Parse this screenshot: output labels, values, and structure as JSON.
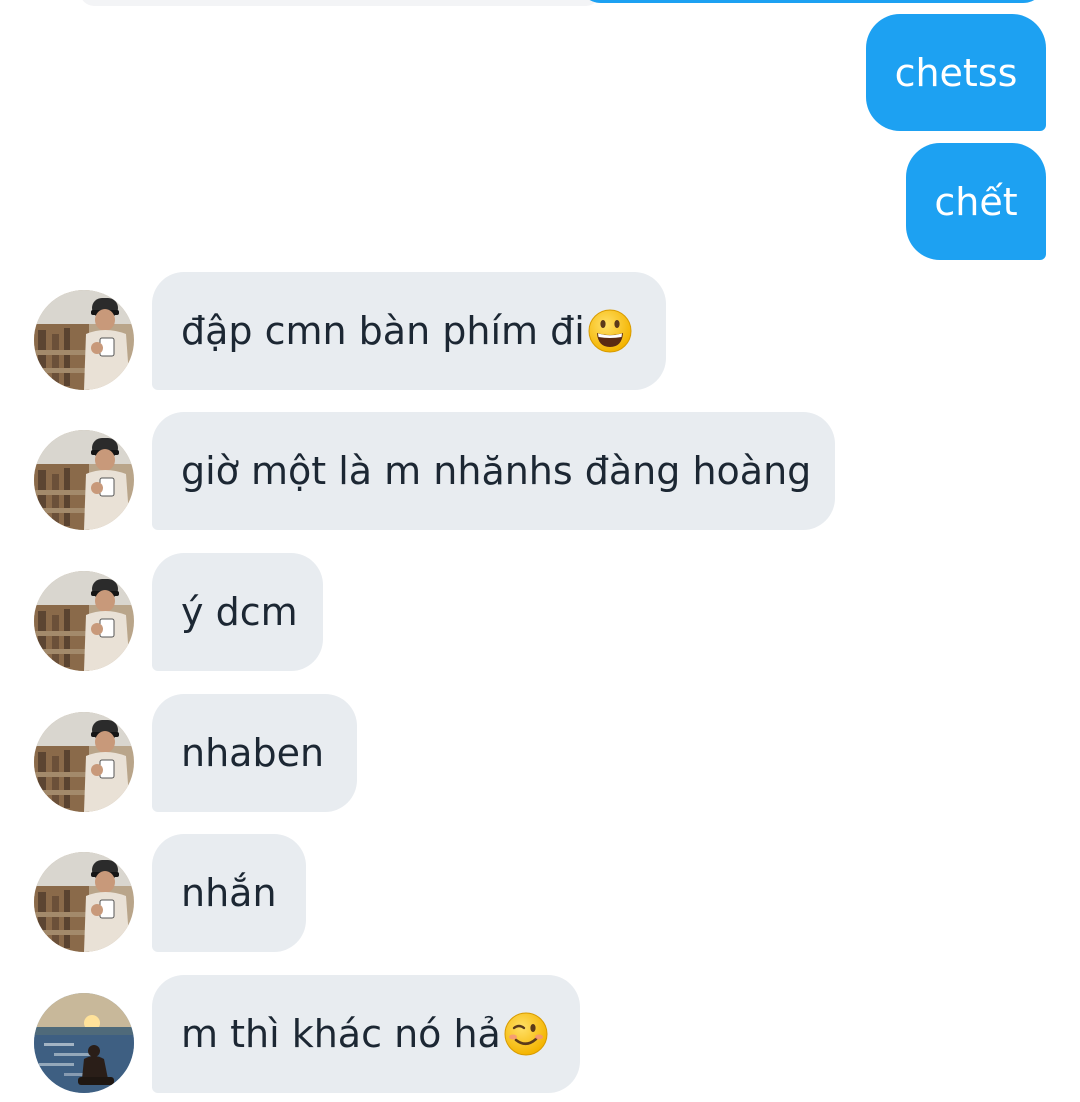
{
  "colors": {
    "outgoing_bubble": "#1da1f2",
    "incoming_bubble": "#e8ecf0",
    "incoming_text": "#1c2733",
    "outgoing_text": "#ffffff"
  },
  "messages": [
    {
      "direction": "outgoing",
      "text": "chetss"
    },
    {
      "direction": "outgoing",
      "text": "chết"
    },
    {
      "direction": "incoming",
      "avatar": "photo-avatar-1",
      "text": "đập cmn bàn phím đi",
      "emoji": "grinning-face-emoji"
    },
    {
      "direction": "incoming",
      "avatar": "photo-avatar-1",
      "text": "giờ một là m nhănhs đàng hoàng"
    },
    {
      "direction": "incoming",
      "avatar": "photo-avatar-1",
      "text": "ý dcm"
    },
    {
      "direction": "incoming",
      "avatar": "photo-avatar-1",
      "text": "nhaben"
    },
    {
      "direction": "incoming",
      "avatar": "photo-avatar-1",
      "text": "nhắn"
    },
    {
      "direction": "incoming",
      "avatar": "photo-avatar-2",
      "text": "m thì khác nó hả",
      "emoji": "winking-face-emoji"
    }
  ]
}
